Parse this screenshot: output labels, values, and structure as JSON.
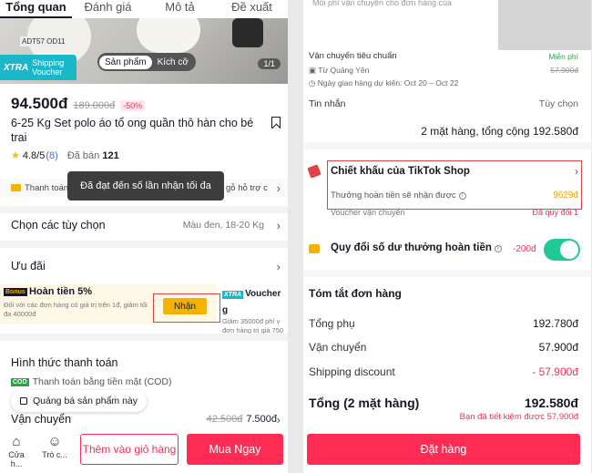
{
  "left": {
    "tabs": [
      "Tổng quan",
      "Đánh giá",
      "Mô tả",
      "Đề xuất"
    ],
    "hero": {
      "tag": "ADT57 OD11",
      "voucher_badge_brand": "XTRA",
      "voucher_badge_text": "Shipping Voucher",
      "segment": [
        "Sản phẩm",
        "Kích cỡ"
      ],
      "counter": "1/1"
    },
    "price": "94.500đ",
    "old_price": "189.000đ",
    "discount": "-50%",
    "title": "6-25 Kg Set polo áo tổ ong quần thô hàn cho bé trai",
    "rating": "4.8",
    "rating_suffix": "/5",
    "rating_count": "(8)",
    "sold_label": "Đã bán",
    "sold_count": "121",
    "ship_line_left": "Thanh toán",
    "ship_line_right": "gỗ hỗ trợ c",
    "toast": "Đã đạt đến số lần nhận tối đa",
    "options_label": "Chọn các tùy chọn",
    "options_value": "Màu đen, 18-20 Kg",
    "offers_label": "Ưu đãi",
    "offer1": {
      "badge": "Bonus",
      "title": "Hoàn tiền 5%",
      "desc": "Đối với các đơn hàng có giá trị trên 1đ, giảm tối đa 40000đ",
      "button": "Nhận"
    },
    "offer2": {
      "brand": "XTRA",
      "title": "Voucher g",
      "desc1": "Giảm 35000đ phí v",
      "desc2": "đơn hàng trị giá 750"
    },
    "payment_label": "Hình thức thanh toán",
    "cod_badge": "COD",
    "cod_text": "Thanh toán bằng tiền mặt (COD)",
    "promo_pill": "Quảng bá sản phẩm này",
    "shipping_label": "Vận chuyển",
    "shipping_old": "42.500đ",
    "shipping_new": "7.500đ",
    "bottom": {
      "shop": "Cửa h...",
      "chat": "Trò c...",
      "add_cart": "Thêm vào giỏ hàng",
      "buy_now": "Mua Ngay"
    }
  },
  "right": {
    "top_cut": "Mỗi phí vận chuyển cho đơn hàng của",
    "ship_title": "Vận chuyển tiêu chuẩn",
    "free": "Miễn phí",
    "from": "Từ Quảng Yên",
    "old_ship": "57.900đ",
    "eta": "Ngày giao hàng dự kiến: Oct 20 – Oct 22",
    "msg_label": "Tin nhắn",
    "msg_value": "Tùy chọn",
    "items_total": "2 mặt hàng, tổng cộng 192.580đ",
    "tts_title": "Chiết khấu của TikTok Shop",
    "tts_sub": "Thưởng hoàn tiền sẽ nhận được",
    "tts_value": "9629đ",
    "voucher_ship": "Voucher vận chuyển",
    "voucher_ship_value": "Đã quy đổi 1",
    "redeem": "Quy đổi số dư thưởng hoàn tiền",
    "redeem_value": "-200đ",
    "summary_title": "Tóm tắt đơn hàng",
    "summary": [
      {
        "label": "Tổng phụ",
        "value": "192.780đ"
      },
      {
        "label": "Vận chuyển",
        "value": "57.900đ"
      },
      {
        "label": "Shipping discount",
        "value": "- 57.900đ"
      }
    ],
    "grand_label": "Tổng (2 mặt hàng)",
    "grand_value": "192.580đ",
    "saved": "Bạn đã tiết kiệm được 57.900đ",
    "order_button": "Đặt hàng"
  }
}
